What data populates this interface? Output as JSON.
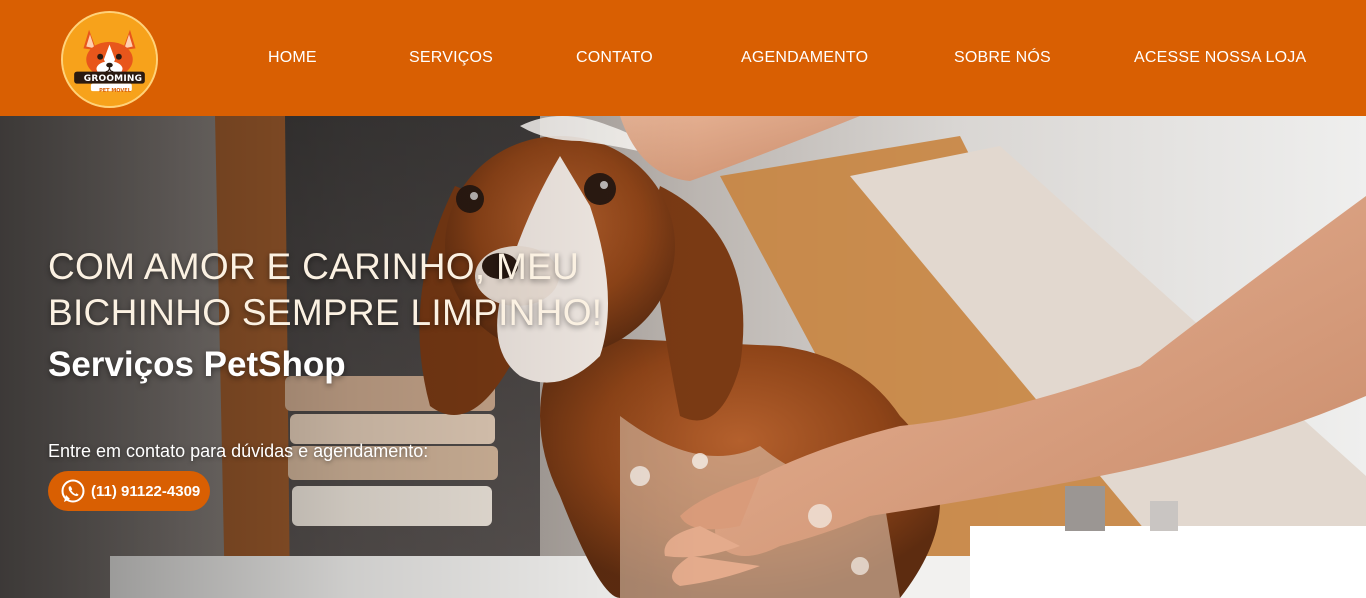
{
  "logo": {
    "text_main": "GROOMING",
    "text_sub": "PET MOVEL",
    "icon": "corgi-dog-icon"
  },
  "nav": {
    "items": [
      {
        "label": "HOME"
      },
      {
        "label": "SERVIÇOS"
      },
      {
        "label": "CONTATO"
      },
      {
        "label": "AGENDAMENTO"
      },
      {
        "label": "SOBRE NÓS"
      },
      {
        "label": "ACESSE NOSSA LOJA"
      }
    ]
  },
  "hero": {
    "headline_line1": "COM AMOR E CARINHO, MEU",
    "headline_line2": "BICHINHO SEMPRE LIMPINHO!",
    "subheadline": "Serviços PetShop",
    "contact_text": "Entre em contato para dúvidas e agendamento:",
    "phone": "(11) 91122-4309",
    "phone_icon": "whatsapp-icon"
  },
  "colors": {
    "brand": "#d95f02",
    "text_light": "#ffffff",
    "headline": "#fbf1e2"
  }
}
